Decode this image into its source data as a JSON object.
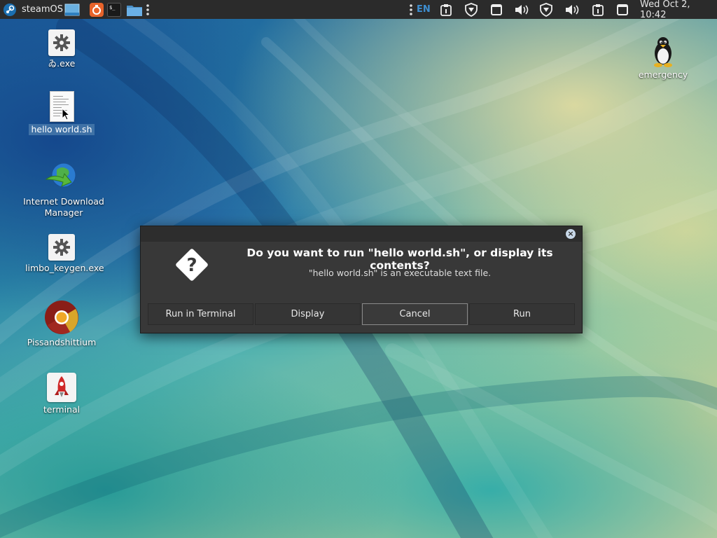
{
  "panel": {
    "app_name": "steamOS",
    "language": "EN",
    "clock": "Wed Oct  2, 10:42",
    "icons": [
      "steam-icon",
      "desktop-icon",
      "ubuntu-software-icon",
      "terminal-icon",
      "files-icon",
      "menu-dots-icon",
      "menu-dots-icon",
      "clipboard-icon",
      "shield-icon",
      "window-icon",
      "volume-icon",
      "shield-icon",
      "volume-icon",
      "clipboard-icon",
      "window-icon"
    ]
  },
  "desktop": {
    "icons": [
      {
        "label": "ゐ.exe",
        "icon": "gear-icon"
      },
      {
        "label": "hello world.sh",
        "icon": "text-file-icon"
      },
      {
        "label": "Internet Download Manager",
        "icon": "idm-globe-icon"
      },
      {
        "label": "limbo_keygen.exe",
        "icon": "gear-icon"
      },
      {
        "label": "Pissandshittium",
        "icon": "chrome-icon"
      },
      {
        "label": "terminal",
        "icon": "rocket-icon"
      },
      {
        "label": "emergency",
        "icon": "tux-penguin-icon"
      }
    ]
  },
  "dialog": {
    "heading": "Do you want to run \"hello world.sh\", or display its contents?",
    "subtext": "\"hello world.sh\" is an executable text file.",
    "buttons": {
      "run_in_terminal": "Run in Terminal",
      "display": "Display",
      "cancel": "Cancel",
      "run": "Run"
    }
  },
  "colors": {
    "panel_bg": "#2b2b2b",
    "dialog_bg": "#383838",
    "accent_lang": "#3e8ed0"
  }
}
